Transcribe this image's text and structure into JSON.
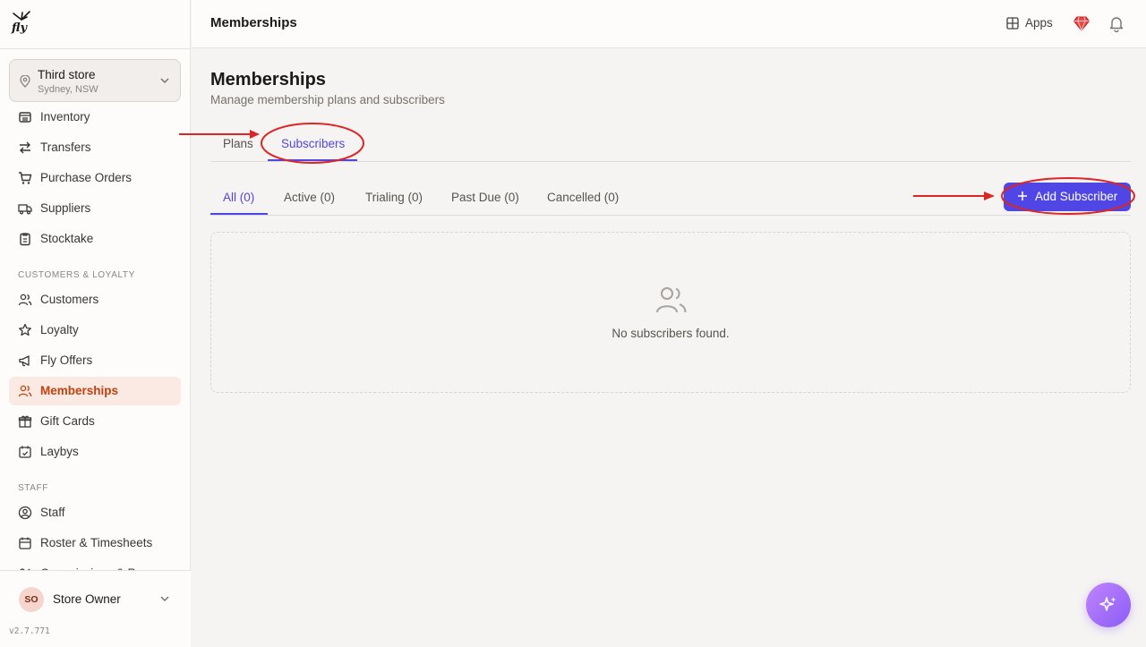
{
  "sidebar": {
    "brand": "fly",
    "store": {
      "name": "Third store",
      "location": "Sydney, NSW"
    },
    "items_top": [
      {
        "label": "Inventory",
        "icon": "inventory-icon"
      },
      {
        "label": "Transfers",
        "icon": "transfer-arrows-icon"
      },
      {
        "label": "Purchase Orders",
        "icon": "cart-icon"
      },
      {
        "label": "Suppliers",
        "icon": "truck-icon"
      },
      {
        "label": "Stocktake",
        "icon": "clipboard-icon"
      }
    ],
    "section_customers": "CUSTOMERS & LOYALTY",
    "items_customers": [
      {
        "label": "Customers",
        "icon": "users-icon"
      },
      {
        "label": "Loyalty",
        "icon": "star-icon"
      },
      {
        "label": "Fly Offers",
        "icon": "megaphone-icon"
      },
      {
        "label": "Memberships",
        "icon": "users-icon",
        "active": true
      },
      {
        "label": "Gift Cards",
        "icon": "gift-icon"
      },
      {
        "label": "Laybys",
        "icon": "calendar-check-icon"
      }
    ],
    "section_staff": "STAFF",
    "items_staff": [
      {
        "label": "Staff",
        "icon": "user-circle-icon"
      },
      {
        "label": "Roster & Timesheets",
        "icon": "calendar-icon"
      },
      {
        "label": "Commissions & Pay",
        "icon": "commission-icon"
      }
    ],
    "user": {
      "initials": "SO",
      "name": "Store Owner"
    },
    "version": "v2.7.771"
  },
  "topbar": {
    "title": "Memberships",
    "apps_label": "Apps"
  },
  "main": {
    "title": "Memberships",
    "subtitle": "Manage membership plans and subscribers",
    "tabs": [
      "Plans",
      "Subscribers"
    ],
    "active_tab": "Subscribers",
    "filters": [
      "All (0)",
      "Active (0)",
      "Trialing (0)",
      "Past Due (0)",
      "Cancelled (0)"
    ],
    "active_filter": "All (0)",
    "add_button": "Add Subscriber",
    "empty_message": "No subscribers found."
  },
  "colors": {
    "accent": "#4f46e5",
    "brand": "#c2410c",
    "annotation": "#dc2626",
    "fab": "#8b5cf6"
  }
}
